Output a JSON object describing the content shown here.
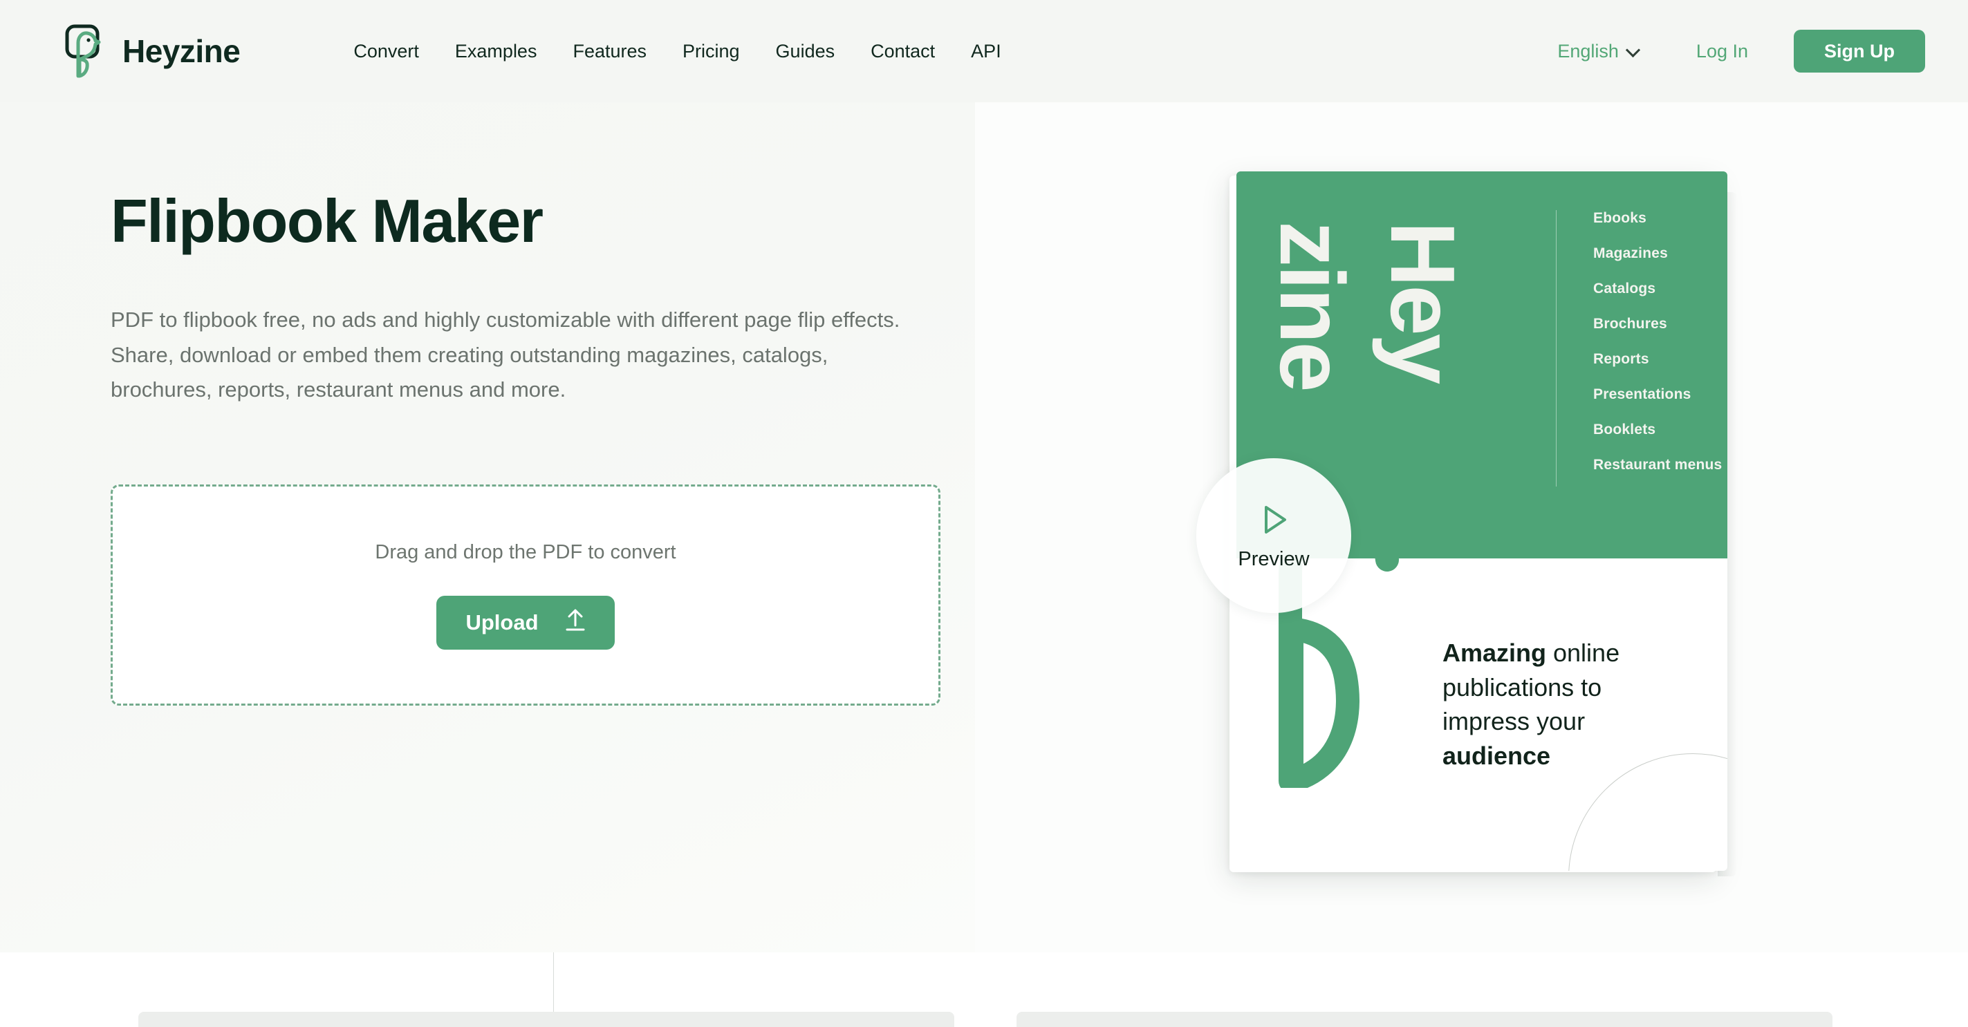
{
  "header": {
    "brand": "Heyzine",
    "nav": [
      {
        "label": "Convert"
      },
      {
        "label": "Examples"
      },
      {
        "label": "Features"
      },
      {
        "label": "Pricing"
      },
      {
        "label": "Guides"
      },
      {
        "label": "Contact"
      },
      {
        "label": "API"
      }
    ],
    "language": "English",
    "login": "Log In",
    "signup": "Sign Up"
  },
  "hero": {
    "title": "Flipbook Maker",
    "description": "PDF to flipbook free, no ads and highly customizable with different page flip effects. Share, download or embed them creating outstanding magazines, catalogs, brochures, reports, restaurant menus and more.",
    "dropzone_text": "Drag and drop the PDF to convert",
    "upload_label": "Upload"
  },
  "preview": {
    "label": "Preview"
  },
  "book": {
    "cover_word_top": "Hey",
    "cover_word_bottom": "zine",
    "cover_list": [
      "Ebooks",
      "Magazines",
      "Catalogs",
      "Brochures",
      "Reports",
      "Presentations",
      "Booklets",
      "Restaurant menus"
    ],
    "page_headline_bold_1": "Amazing",
    "page_headline_mid": " online publications to impress your ",
    "page_headline_bold_2": "audience"
  },
  "colors": {
    "brand_green": "#4ea477",
    "dark_green": "#0d2a1f",
    "link_green": "#52a776",
    "hero_bg": "#f5f7f4",
    "header_bg": "#f4f6f3",
    "muted_text": "#6b736e"
  }
}
